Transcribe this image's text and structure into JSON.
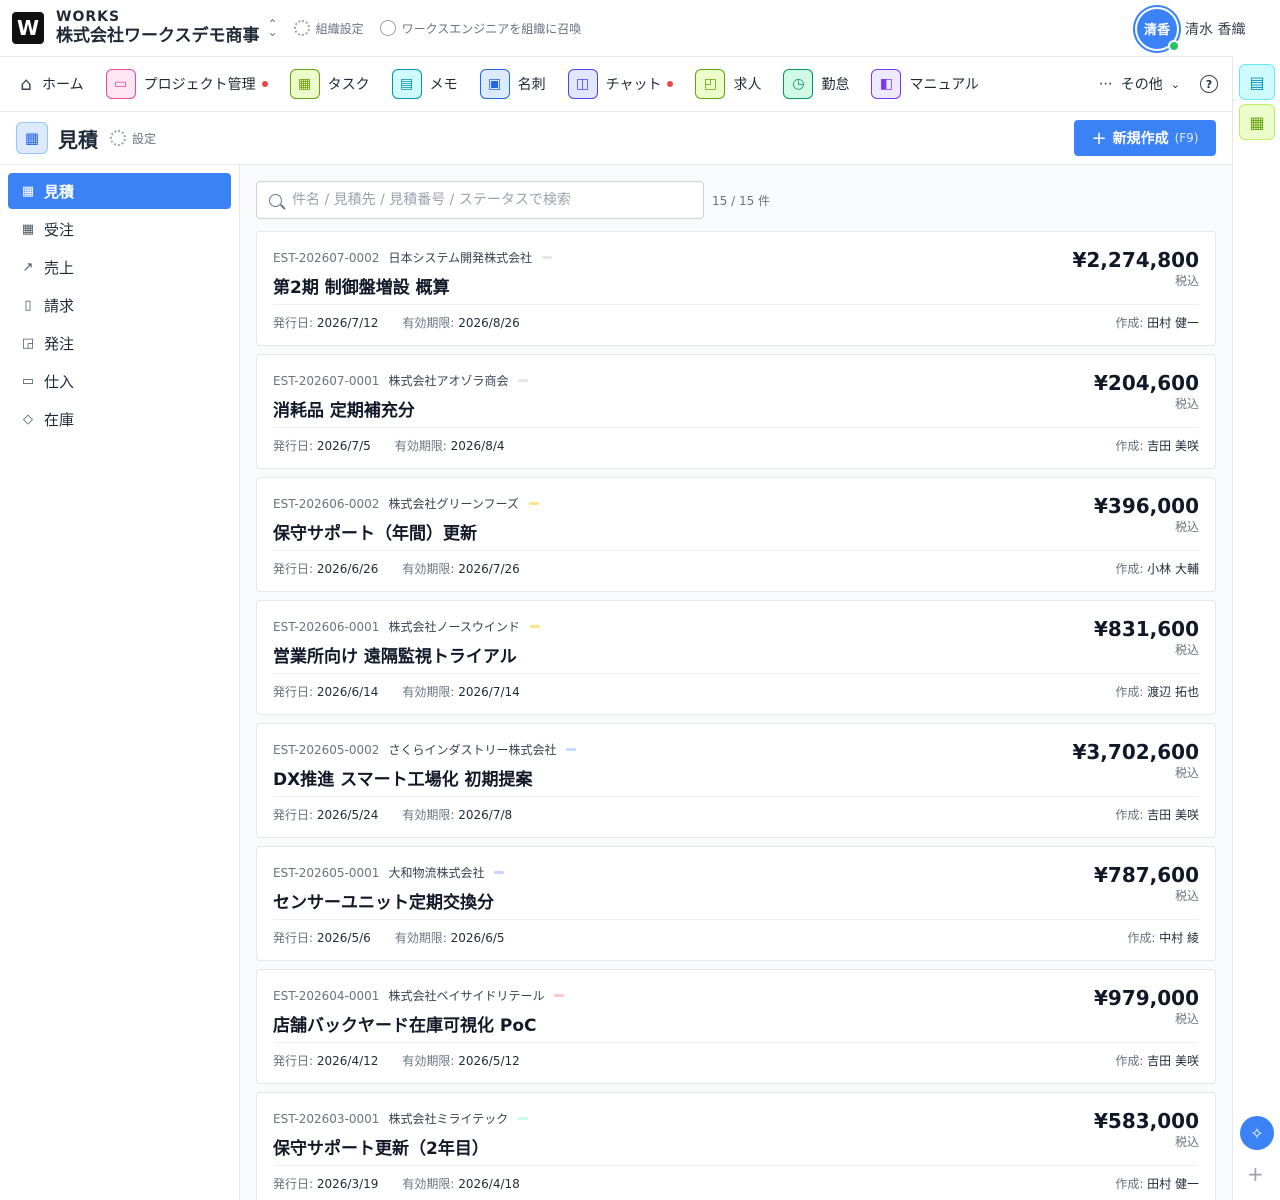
{
  "header": {
    "logo_letter": "W",
    "brand": "WORKS",
    "org_name": "株式会社ワークスデモ商事",
    "org_settings": "組織設定",
    "invite": "ワークスエンジニアを組織に召喚",
    "user_avatar_text": "清香",
    "user_name": "清水 香織"
  },
  "nav": {
    "home": "ホーム",
    "items": [
      {
        "label": "プロジェクト管理",
        "icon": "folder-icon",
        "color": "#ec4899",
        "bg": "#fce7f3",
        "dot": true
      },
      {
        "label": "タスク",
        "icon": "clipboard-icon",
        "color": "#65a30d",
        "bg": "#ecfccb",
        "dot": false
      },
      {
        "label": "メモ",
        "icon": "document-icon",
        "color": "#0891b2",
        "bg": "#cffafe",
        "dot": false
      },
      {
        "label": "名刺",
        "icon": "id-card-icon",
        "color": "#2563eb",
        "bg": "#dbeafe",
        "dot": false
      },
      {
        "label": "チャット",
        "icon": "chat-icon",
        "color": "#4f46e5",
        "bg": "#e0e7ff",
        "dot": true
      },
      {
        "label": "求人",
        "icon": "briefcase-icon",
        "color": "#65a30d",
        "bg": "#ecfccb",
        "dot": false
      },
      {
        "label": "勤怠",
        "icon": "clock-icon",
        "color": "#059669",
        "bg": "#d1fae5",
        "dot": false
      },
      {
        "label": "マニュアル",
        "icon": "book-icon",
        "color": "#7c3aed",
        "bg": "#ede9fe",
        "dot": false
      }
    ],
    "more": "その他",
    "help": "?"
  },
  "page": {
    "title": "見積",
    "settings": "設定",
    "new_button": "新規作成",
    "new_shortcut": "(F9)"
  },
  "sidebar": {
    "items": [
      {
        "label": "見積",
        "icon": "clipboard-icon",
        "active": true
      },
      {
        "label": "受注",
        "icon": "clipboard-icon",
        "active": false
      },
      {
        "label": "売上",
        "icon": "trend-icon",
        "active": false
      },
      {
        "label": "請求",
        "icon": "invoice-icon",
        "active": false
      },
      {
        "label": "発注",
        "icon": "bag-icon",
        "active": false
      },
      {
        "label": "仕入",
        "icon": "archive-icon",
        "active": false
      },
      {
        "label": "在庫",
        "icon": "box-icon",
        "active": false
      }
    ]
  },
  "search": {
    "placeholder": "件名 / 見積先 / 見積番号 / ステータスで検索",
    "value": "",
    "count": "15 / 15 件"
  },
  "labels": {
    "issued": "発行日: ",
    "expiry": "有効期限: ",
    "author": "作成: ",
    "tax": "税込"
  },
  "estimates": [
    {
      "no": "EST-202607-0002",
      "client": "日本システム開発株式会社",
      "status_color": "#e5e7eb",
      "title": "第2期 制御盤増設 概算",
      "amount": "¥2,274,800",
      "issued": "2026/7/12",
      "expiry": "2026/8/26",
      "author": "田村 健一"
    },
    {
      "no": "EST-202607-0001",
      "client": "株式会社アオゾラ商会",
      "status_color": "#e5e7eb",
      "title": "消耗品 定期補充分",
      "amount": "¥204,600",
      "issued": "2026/7/5",
      "expiry": "2026/8/4",
      "author": "吉田 美咲"
    },
    {
      "no": "EST-202606-0002",
      "client": "株式会社グリーンフーズ",
      "status_color": "#fde68a",
      "title": "保守サポート（年間）更新",
      "amount": "¥396,000",
      "issued": "2026/6/26",
      "expiry": "2026/7/26",
      "author": "小林 大輔"
    },
    {
      "no": "EST-202606-0001",
      "client": "株式会社ノースウインド",
      "status_color": "#fde68a",
      "title": "営業所向け 遠隔監視トライアル",
      "amount": "¥831,600",
      "issued": "2026/6/14",
      "expiry": "2026/7/14",
      "author": "渡辺 拓也"
    },
    {
      "no": "EST-202605-0002",
      "client": "さくらインダストリー株式会社",
      "status_color": "#bfdbfe",
      "title": "DX推進 スマート工場化 初期提案",
      "amount": "¥3,702,600",
      "issued": "2026/5/24",
      "expiry": "2026/7/8",
      "author": "吉田 美咲"
    },
    {
      "no": "EST-202605-0001",
      "client": "大和物流株式会社",
      "status_color": "#c7d2fe",
      "title": "センサーユニット定期交換分",
      "amount": "¥787,600",
      "issued": "2026/5/6",
      "expiry": "2026/6/5",
      "author": "中村 綾"
    },
    {
      "no": "EST-202604-0001",
      "client": "株式会社ベイサイドリテール",
      "status_color": "#fecaca",
      "title": "店舗バックヤード在庫可視化 PoC",
      "amount": "¥979,000",
      "issued": "2026/4/12",
      "expiry": "2026/5/12",
      "author": "吉田 美咲"
    },
    {
      "no": "EST-202603-0001",
      "client": "株式会社ミライテック",
      "status_color": "#ccfbf1",
      "title": "保守サポート更新（2年目）",
      "amount": "¥583,000",
      "issued": "2026/3/19",
      "expiry": "2026/4/18",
      "author": "田村 健一"
    }
  ]
}
